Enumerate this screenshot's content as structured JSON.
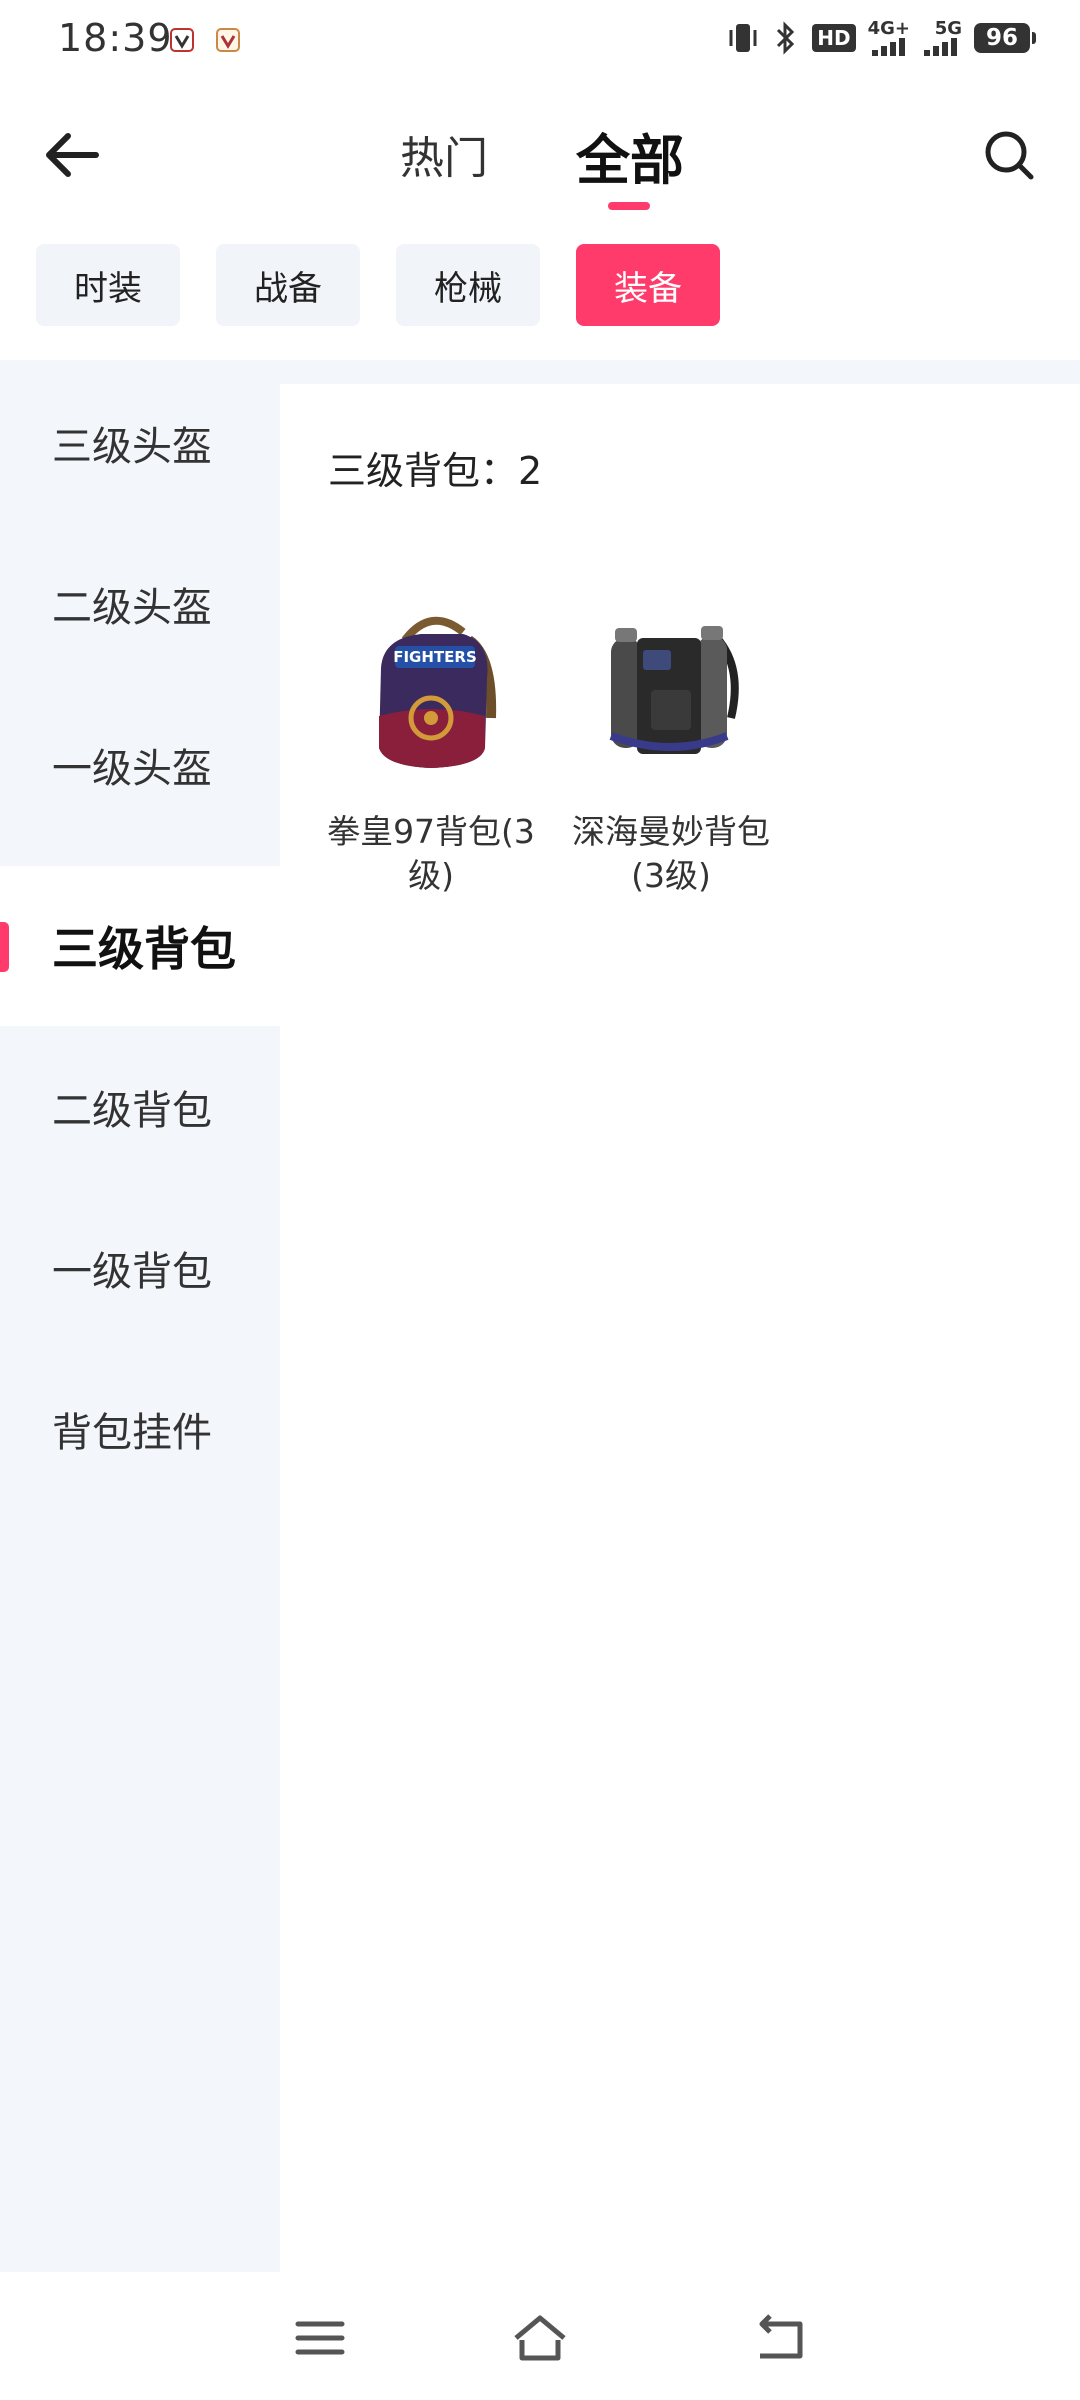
{
  "status_bar": {
    "time": "18:39",
    "hd_label": "HD",
    "net1": "4G+",
    "net2": "5G",
    "battery": "96"
  },
  "header": {
    "tabs": [
      {
        "label": "热门",
        "active": false
      },
      {
        "label": "全部",
        "active": true
      }
    ],
    "accent_color": "#ff3b6b"
  },
  "chips": [
    {
      "label": "时装",
      "active": false
    },
    {
      "label": "战备",
      "active": false
    },
    {
      "label": "枪械",
      "active": false
    },
    {
      "label": "装备",
      "active": true
    }
  ],
  "sidebar": {
    "items": [
      {
        "label": "三级头盔",
        "active": false
      },
      {
        "label": "二级头盔",
        "active": false
      },
      {
        "label": "一级头盔",
        "active": false
      },
      {
        "label": "三级背包",
        "active": true
      },
      {
        "label": "二级背包",
        "active": false
      },
      {
        "label": "一级背包",
        "active": false
      },
      {
        "label": "背包挂件",
        "active": false
      }
    ]
  },
  "main": {
    "heading": "三级背包：2",
    "items": [
      {
        "name": "拳皇97背包(3级)",
        "icon": "kof97-backpack-icon"
      },
      {
        "name": "深海曼妙背包(3级)",
        "icon": "deep-sea-backpack-icon"
      }
    ]
  },
  "nav": {
    "icons": [
      "menu-icon",
      "home-icon",
      "back-icon"
    ]
  }
}
